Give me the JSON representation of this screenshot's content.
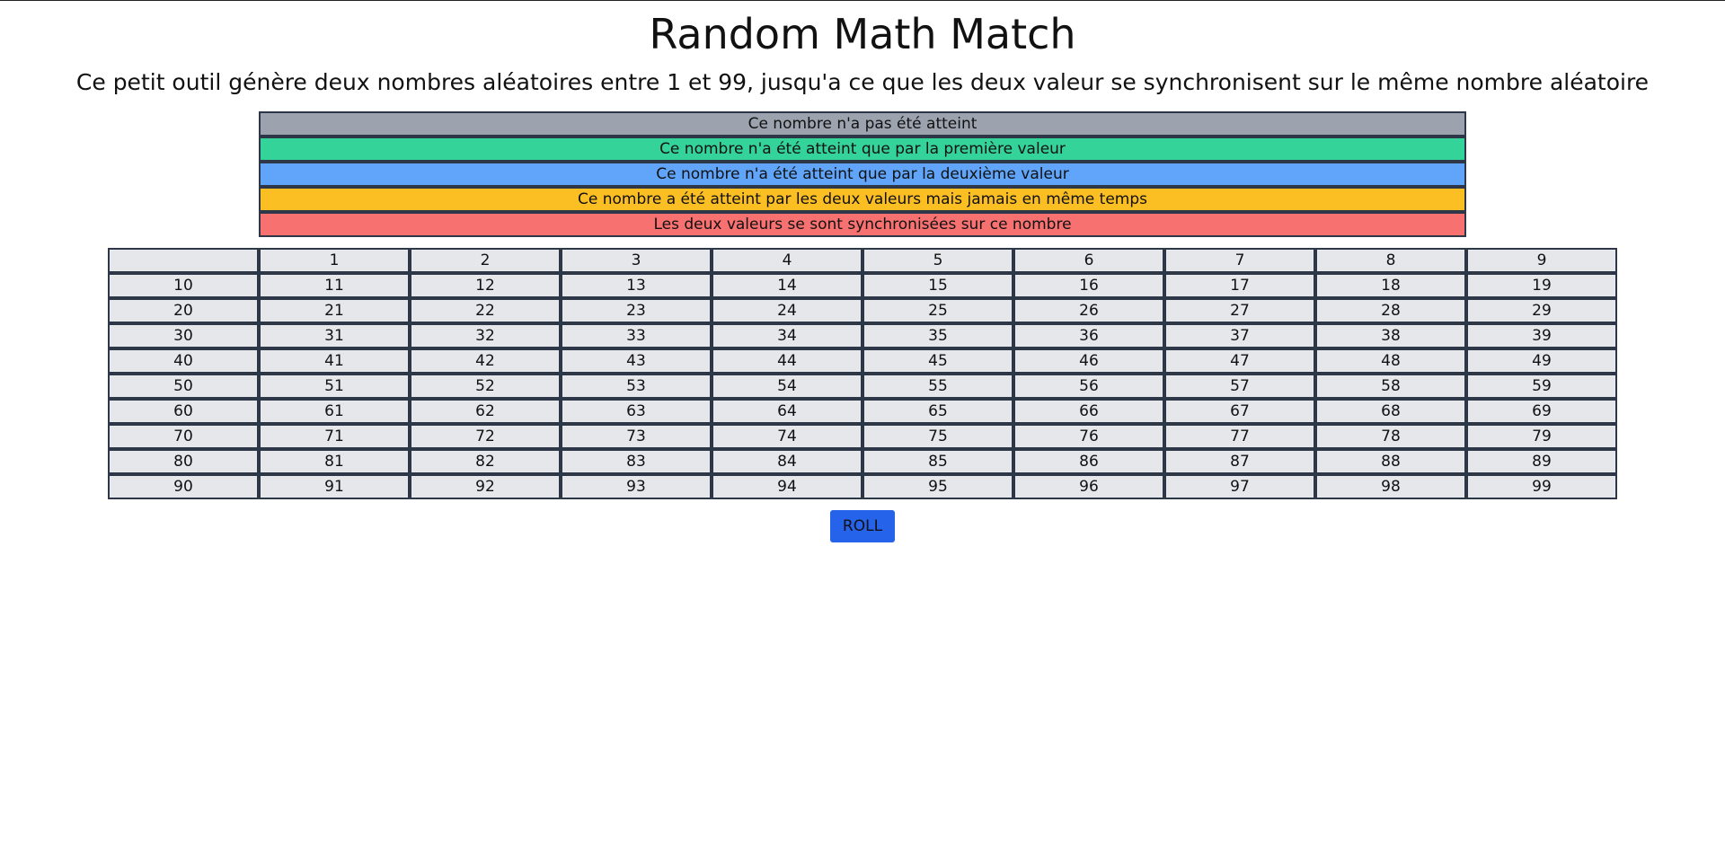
{
  "header": {
    "title": "Random Math Match",
    "subtitle": "Ce petit outil génère deux nombres aléatoires entre 1 et 99, jusqu'a ce que les deux valeur se synchronisent sur le même nombre aléatoire"
  },
  "legend": [
    {
      "label": "Ce nombre n'a pas été atteint",
      "color": "#9ca3af"
    },
    {
      "label": "Ce nombre n'a été atteint que par la première valeur",
      "color": "#34d399"
    },
    {
      "label": "Ce nombre n'a été atteint que par la deuxième valeur",
      "color": "#60a5fa"
    },
    {
      "label": "Ce nombre a été atteint par les deux valeurs mais jamais en même temps",
      "color": "#fbbf24"
    },
    {
      "label": "Les deux valeurs se sont synchronisées sur ce nombre",
      "color": "#f87171"
    }
  ],
  "grid": {
    "cells": [
      "",
      "1",
      "2",
      "3",
      "4",
      "5",
      "6",
      "7",
      "8",
      "9",
      "10",
      "11",
      "12",
      "13",
      "14",
      "15",
      "16",
      "17",
      "18",
      "19",
      "20",
      "21",
      "22",
      "23",
      "24",
      "25",
      "26",
      "27",
      "28",
      "29",
      "30",
      "31",
      "32",
      "33",
      "34",
      "35",
      "36",
      "37",
      "38",
      "39",
      "40",
      "41",
      "42",
      "43",
      "44",
      "45",
      "46",
      "47",
      "48",
      "49",
      "50",
      "51",
      "52",
      "53",
      "54",
      "55",
      "56",
      "57",
      "58",
      "59",
      "60",
      "61",
      "62",
      "63",
      "64",
      "65",
      "66",
      "67",
      "68",
      "69",
      "70",
      "71",
      "72",
      "73",
      "74",
      "75",
      "76",
      "77",
      "78",
      "79",
      "80",
      "81",
      "82",
      "83",
      "84",
      "85",
      "86",
      "87",
      "88",
      "89",
      "90",
      "91",
      "92",
      "93",
      "94",
      "95",
      "96",
      "97",
      "98",
      "99"
    ]
  },
  "actions": {
    "roll_label": "ROLL"
  },
  "colors": {
    "cell_default": "#e5e7eb",
    "border": "#2d3748",
    "button": "#2563eb"
  }
}
